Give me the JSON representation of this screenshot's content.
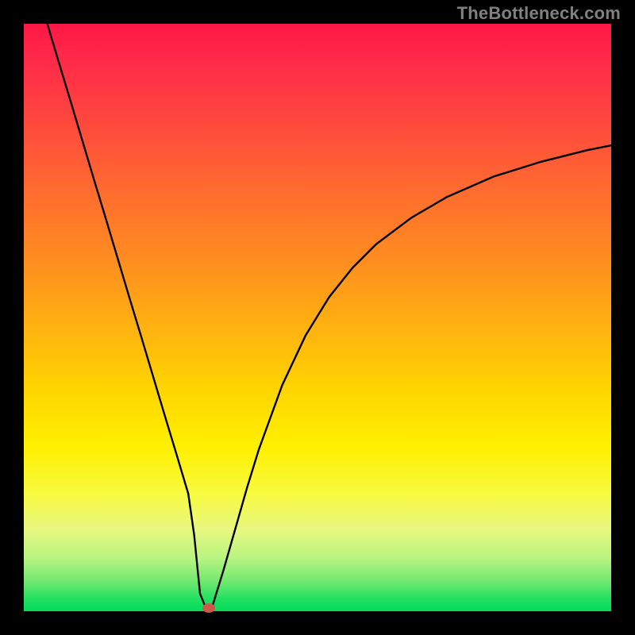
{
  "watermark": "TheBottleneck.com",
  "colors": {
    "frame": "#000000",
    "curve": "#000000",
    "dot": "#c95a4a",
    "watermark": "#808080"
  },
  "chart_data": {
    "type": "line",
    "title": "",
    "xlabel": "",
    "ylabel": "",
    "xlim": [
      0,
      100
    ],
    "ylim": [
      0,
      100
    ],
    "grid": false,
    "legend": false,
    "series": [
      {
        "name": "bottleneck-curve",
        "x": [
          4,
          6,
          8,
          10,
          12,
          14,
          16,
          18,
          20,
          22,
          24,
          26,
          28,
          29,
          30,
          31,
          32,
          34,
          36,
          38,
          40,
          44,
          48,
          52,
          56,
          60,
          66,
          72,
          80,
          88,
          96,
          100
        ],
        "y": [
          100,
          93.3,
          86.7,
          80,
          73.3,
          66.7,
          60,
          53.3,
          46.7,
          40,
          33.3,
          26.7,
          20,
          13,
          3,
          0.5,
          0.5,
          7,
          14,
          21,
          27.5,
          38.5,
          47,
          53.5,
          58.5,
          62.5,
          67,
          70.5,
          74,
          76.5,
          78.5,
          79.3
        ]
      }
    ],
    "marker": {
      "x": 31.5,
      "y": 0.5
    }
  }
}
